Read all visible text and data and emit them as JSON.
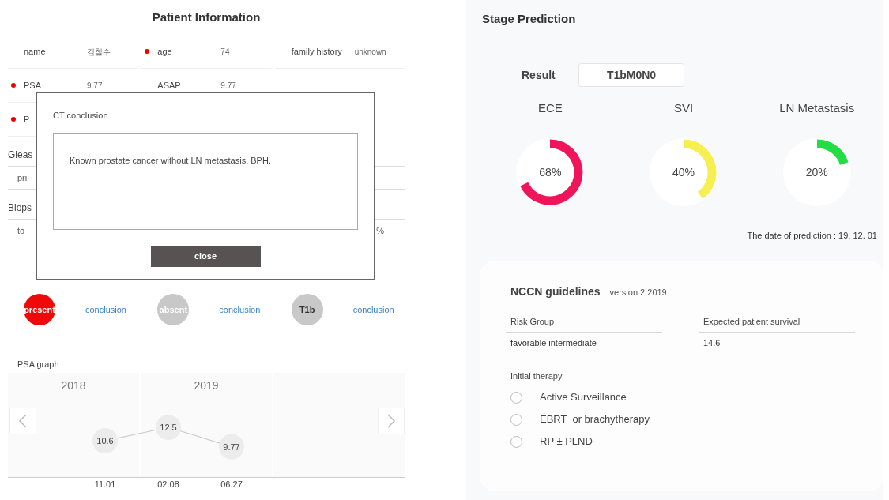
{
  "patient_info": {
    "title": "Patient Information",
    "field_rows": [
      [
        {
          "label": "name",
          "value": "김철수",
          "flagged": false
        },
        {
          "label": "age",
          "value": "74",
          "flagged": true
        },
        {
          "label": "family history",
          "value": "unknown",
          "flagged": false
        }
      ],
      [
        {
          "label": "PSA",
          "value": "9.77",
          "flagged": true
        },
        {
          "label": "ASAP",
          "value": "9.77",
          "flagged": false
        }
      ],
      [
        {
          "label": "P",
          "flagged": true
        }
      ]
    ],
    "partial_rows": [
      {
        "kind": "header",
        "text": "Gleas"
      },
      {
        "kind": "row",
        "text": "pri"
      },
      {
        "kind": "header",
        "text": "Biops"
      },
      {
        "kind": "row",
        "text": "to",
        "end_text": "%"
      }
    ],
    "findings": [
      {
        "kind": "positive",
        "badge": "present",
        "link": "conclusion"
      },
      {
        "kind": "negative",
        "badge": "absent",
        "link": "conclusion"
      },
      {
        "kind": "stage",
        "badge": "T1b",
        "link": "conclusion"
      }
    ],
    "psa_graph": {
      "title": "PSA graph",
      "years": [
        "2018",
        "2019"
      ],
      "chart_data": {
        "type": "line",
        "categories": [
          "11.01",
          "02.08",
          "06.27"
        ],
        "series": [
          {
            "values": [
              10.6,
              12.5,
              9.77
            ],
            "marker": true
          }
        ],
        "data_labels": true
      }
    }
  },
  "modal": {
    "title": "CT conclusion",
    "text": "Known prostate cancer without LN metastasis. BPH.",
    "button": "close"
  },
  "stage_prediction": {
    "title": "Stage Prediction",
    "result_label": "Result",
    "result": "T1bM0N0",
    "gauges": [
      {
        "label": "ECE",
        "reading": "68%",
        "level": 0.68,
        "color": "#f0145a"
      },
      {
        "label": "SVI",
        "reading": "40%",
        "level": 0.4,
        "color": "#f5f050"
      },
      {
        "label": "LN Metastasis",
        "reading": "20%",
        "level": 0.2,
        "color": "#22dd44"
      }
    ],
    "date": "The date of prediction : 19. 12. 01"
  },
  "nccn": {
    "title": "NCCN guidelines",
    "version": "version 2.2019",
    "columns": [
      {
        "header": "Risk Group",
        "value": "favorable intermediate"
      },
      {
        "header": "Expected patient survival",
        "value": "14.6"
      }
    ],
    "therapy_label": "Initial therapy",
    "options": [
      {
        "label": "Active Surveillance",
        "selected": false
      },
      {
        "label": "EBRT  or brachytherapy",
        "selected": false
      },
      {
        "label": "RP ± PLND",
        "selected": false
      }
    ]
  }
}
